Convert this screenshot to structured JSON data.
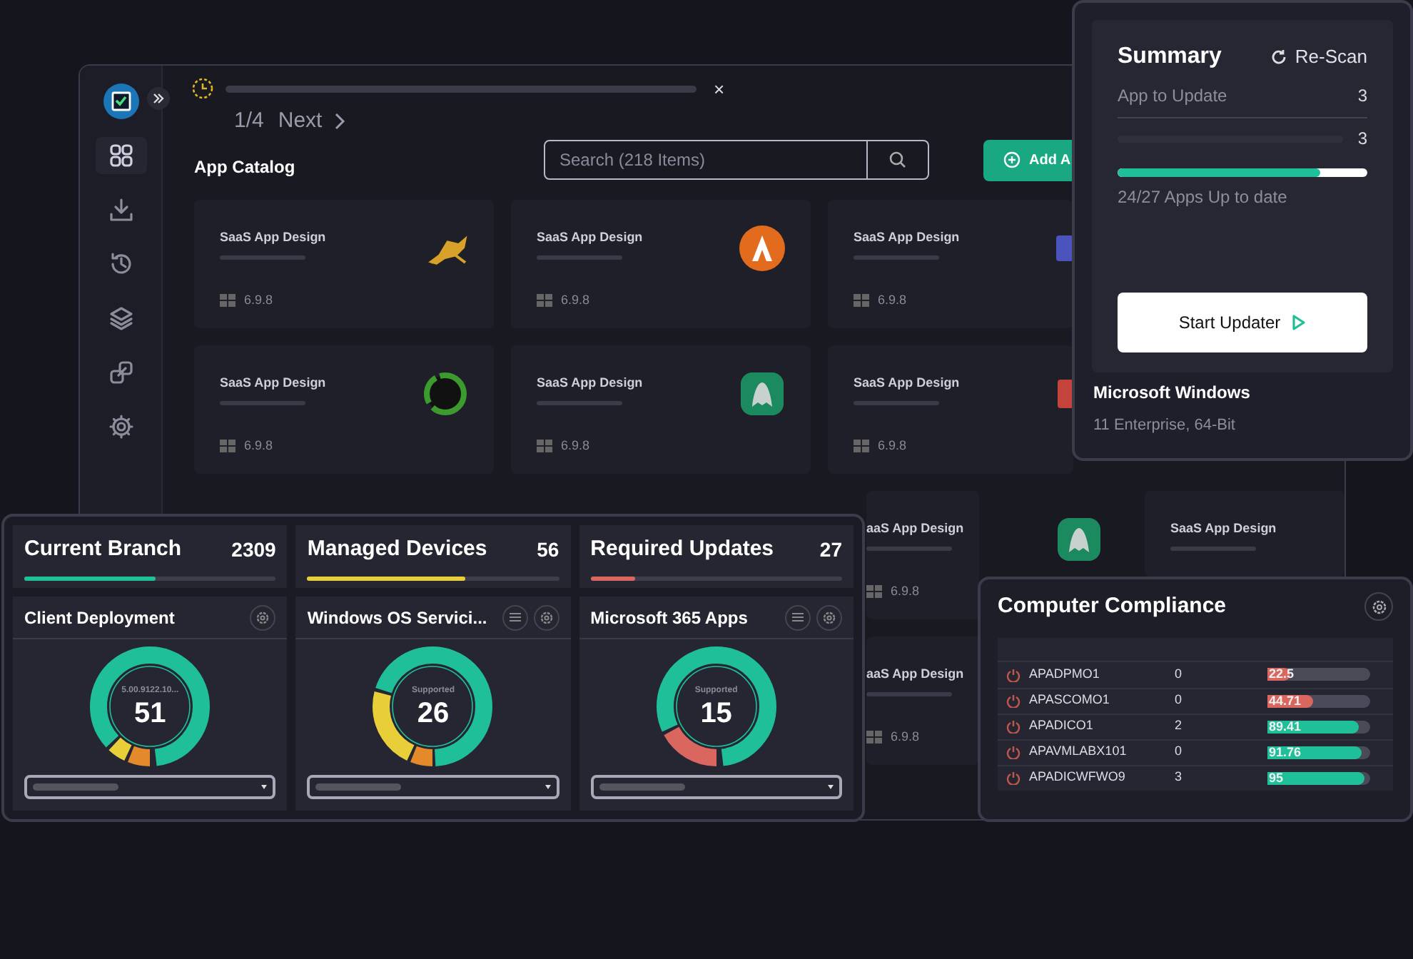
{
  "app_window": {
    "sidebar": {
      "items": [
        {
          "selected": true
        },
        {
          "selected": false
        },
        {
          "selected": false
        },
        {
          "selected": false
        },
        {
          "selected": false
        },
        {
          "selected": false
        }
      ]
    },
    "tour": {
      "level": 0,
      "step": "1/4",
      "next": "Next",
      "close": "×"
    },
    "catalog": {
      "title": "App Catalog",
      "search_placeholder": "Search (218 Items)",
      "add_button": "Add A",
      "cards": [
        {
          "title": "SaaS App Design",
          "version": "6.9.8"
        },
        {
          "title": "SaaS App Design",
          "version": "6.9.8"
        },
        {
          "title": "SaaS App Design",
          "version": "6.9.8"
        },
        {
          "title": "SaaS App Design",
          "version": "6.9.8"
        },
        {
          "title": "SaaS App Design",
          "version": "6.9.8"
        },
        {
          "title": "SaaS App Design",
          "version": "6.9.8"
        },
        {
          "title": "aaS App Design",
          "version": "6.9.8"
        },
        {
          "title": "SaaS App Design"
        },
        {
          "title": "aaS App Design",
          "version": "6.9.8"
        }
      ]
    }
  },
  "summary": {
    "title": "Summary",
    "rescan": "Re-Scan",
    "app_to_update": {
      "label": "App to Update",
      "value": "3"
    },
    "second_value": "3",
    "progress": {
      "level": 0.81,
      "caption": "24/27 Apps Up to date"
    },
    "start_button": "Start Updater",
    "os_name": "Microsoft Windows",
    "os_detail": "11 Enterprise, 64-Bit"
  },
  "stats": [
    {
      "title": "Current Branch",
      "value": "2309",
      "level": 0.52,
      "color": "#1fbf9a"
    },
    {
      "title": "Managed Devices",
      "value": "56",
      "level": 0.63,
      "color": "#e8cf3a"
    },
    {
      "title": "Required Updates",
      "value": "27",
      "level": 0.18,
      "color": "#d9675f"
    }
  ],
  "widgets": [
    {
      "title": "Client Deployment",
      "menu_button": false,
      "center_label": "5.00.9122.10...",
      "center_value": "51"
    },
    {
      "title": "Windows OS Servici...",
      "menu_button": true,
      "center_label": "Supported",
      "center_value": "26"
    },
    {
      "title": "Microsoft 365 Apps",
      "menu_button": true,
      "center_label": "Supported",
      "center_value": "15"
    }
  ],
  "compliance": {
    "title": "Computer Compliance",
    "rows": [
      {
        "name": "APADPMO1",
        "count": "0",
        "score": "22.5",
        "level": 0.225,
        "color": "#d9675f"
      },
      {
        "name": "APASCOMO1",
        "count": "0",
        "score": "44.71",
        "level": 0.447,
        "color": "#d9675f"
      },
      {
        "name": "APADICO1",
        "count": "2",
        "score": "89.41",
        "level": 0.894,
        "color": "#1fbf9a"
      },
      {
        "name": "APAVMLABX101",
        "count": "0",
        "score": "91.76",
        "level": 0.918,
        "color": "#1fbf9a"
      },
      {
        "name": "APADICWFWO9",
        "count": "3",
        "score": "95",
        "level": 0.95,
        "color": "#1fbf9a"
      }
    ]
  }
}
